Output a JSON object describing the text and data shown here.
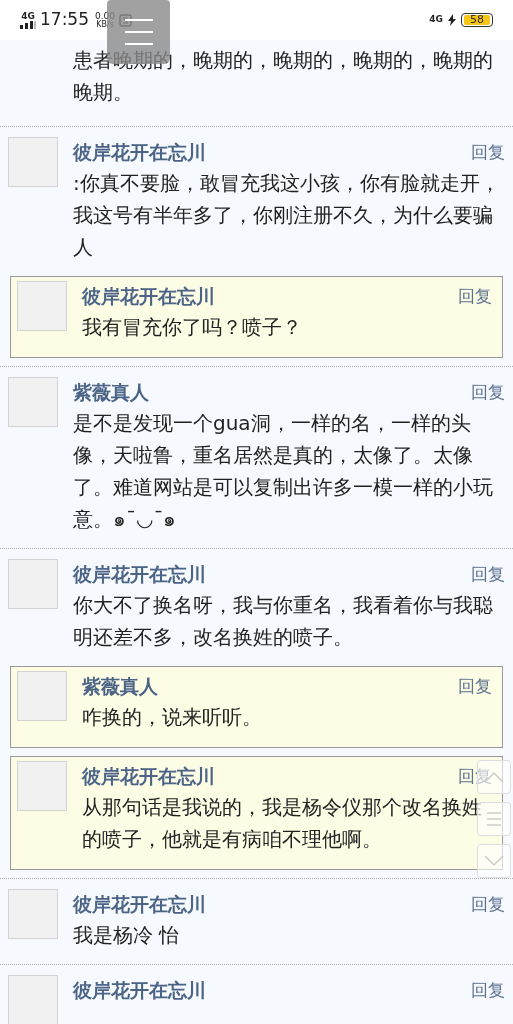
{
  "status_bar": {
    "network": "4G",
    "time": "17:55",
    "speed": "0.00",
    "speed_unit": "KB/s",
    "right_network": "4G",
    "battery": "58"
  },
  "posts": [
    {
      "text": "患者晚期的，晚期的，晚期的，晚期的，晚期的晚期。"
    },
    {
      "author": "彼岸花开在忘川",
      "reply_label": "回复",
      "text": ":你真不要脸，敢冒充我这小孩，你有脸就走开，我这号有半年多了，你刚注册不久，为什么要骗人",
      "replies": [
        {
          "author": "彼岸花开在忘川",
          "reply_label": "回复",
          "text": "我有冒充你了吗？喷子？"
        }
      ]
    },
    {
      "author": "紫薇真人",
      "reply_label": "回复",
      "text": "是不是发现一个gua洞，一样的名，一样的头像，天啦鲁，重名居然是真的，太像了。太像了。难道网站是可以复制出许多一模一样的小玩意。๑¯◡¯๑"
    },
    {
      "author": "彼岸花开在忘川",
      "reply_label": "回复",
      "text": "你大不了换名呀，我与你重名，我看着你与我聪明还差不多，改名换姓的喷子。",
      "replies": [
        {
          "author": "紫薇真人",
          "reply_label": "回复",
          "text": "咋换的，说来听听。"
        },
        {
          "author": "彼岸花开在忘川",
          "reply_label": "回复",
          "text": "从那句话是我说的，我是杨令仪那个改名换姓的喷子，他就是有病咱不理他啊。"
        }
      ]
    },
    {
      "author": "彼岸花开在忘川",
      "reply_label": "回复",
      "text": "我是杨冷 怡"
    },
    {
      "author": "彼岸花开在忘川",
      "reply_label": "回复"
    }
  ]
}
